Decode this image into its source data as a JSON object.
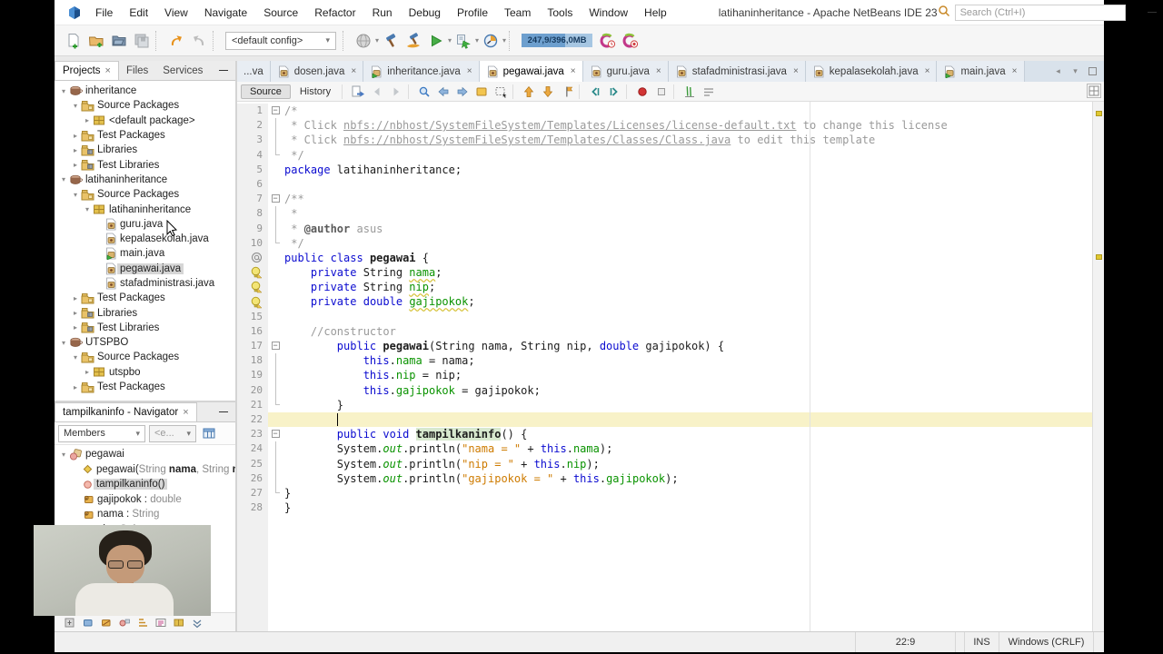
{
  "titlebar": {
    "menus": [
      "File",
      "Edit",
      "View",
      "Navigate",
      "Source",
      "Refactor",
      "Run",
      "Debug",
      "Profile",
      "Team",
      "Tools",
      "Window",
      "Help"
    ],
    "title": "latihaninheritance - Apache NetBeans IDE 23",
    "search_placeholder": "Search (Ctrl+I)"
  },
  "toolbar": {
    "file_icons": [
      "new-file",
      "new-project",
      "open-project",
      "save-all"
    ],
    "edit_icons": [
      "undo",
      "redo"
    ],
    "config_value": "<default config>",
    "run_icons": [
      "web",
      "build",
      "clean-build",
      "run",
      "debug",
      "profile"
    ],
    "memory_label": "247,9/396,0MB",
    "gc_icons": [
      "gc-time",
      "gc-stop"
    ]
  },
  "projects": {
    "tabs": [
      {
        "label": "Projects",
        "active": true,
        "closable": true
      },
      {
        "label": "Files",
        "active": false,
        "closable": false
      },
      {
        "label": "Services",
        "active": false,
        "closable": false
      }
    ],
    "tree": [
      {
        "d": 0,
        "a": "v",
        "icon": "project",
        "label": "inheritance"
      },
      {
        "d": 1,
        "a": "v",
        "icon": "src-pkg",
        "label": "Source Packages"
      },
      {
        "d": 2,
        "a": ">",
        "icon": "package",
        "label": "<default package>"
      },
      {
        "d": 1,
        "a": ">",
        "icon": "src-pkg",
        "label": "Test Packages"
      },
      {
        "d": 1,
        "a": ">",
        "icon": "lib",
        "label": "Libraries"
      },
      {
        "d": 1,
        "a": ">",
        "icon": "lib",
        "label": "Test Libraries"
      },
      {
        "d": 0,
        "a": "v",
        "icon": "project",
        "label": "latihaninheritance"
      },
      {
        "d": 1,
        "a": "v",
        "icon": "src-pkg",
        "label": "Source Packages"
      },
      {
        "d": 2,
        "a": "v",
        "icon": "package",
        "label": "latihaninheritance"
      },
      {
        "d": 3,
        "a": null,
        "icon": "class",
        "label": "guru.java"
      },
      {
        "d": 3,
        "a": null,
        "icon": "class",
        "label": "kepalasekolah.java"
      },
      {
        "d": 3,
        "a": null,
        "icon": "main-class",
        "label": "main.java"
      },
      {
        "d": 3,
        "a": null,
        "icon": "class",
        "label": "pegawai.java",
        "selected": true
      },
      {
        "d": 3,
        "a": null,
        "icon": "class",
        "label": "stafadministrasi.java"
      },
      {
        "d": 1,
        "a": ">",
        "icon": "src-pkg",
        "label": "Test Packages"
      },
      {
        "d": 1,
        "a": ">",
        "icon": "lib",
        "label": "Libraries"
      },
      {
        "d": 1,
        "a": ">",
        "icon": "lib",
        "label": "Test Libraries"
      },
      {
        "d": 0,
        "a": "v",
        "icon": "project",
        "label": "UTSPBO"
      },
      {
        "d": 1,
        "a": "v",
        "icon": "src-pkg",
        "label": "Source Packages"
      },
      {
        "d": 2,
        "a": ">",
        "icon": "package",
        "label": "utspbo"
      },
      {
        "d": 1,
        "a": ">",
        "icon": "src-pkg",
        "label": "Test Packages"
      }
    ]
  },
  "navigator": {
    "title": "tampilkaninfo - Navigator",
    "filter_value": "Members",
    "filter2_value": "<e...",
    "items": [
      {
        "icon": "nav-class",
        "d": 0,
        "a": "v",
        "segs": [
          [
            "p",
            "pegawai"
          ]
        ]
      },
      {
        "icon": "constructor",
        "d": 1,
        "a": null,
        "segs": [
          [
            "p",
            "pegawai("
          ],
          [
            "nav-dim",
            "String "
          ],
          [
            "nav-b",
            "nama"
          ],
          [
            "nav-dim",
            ", String "
          ],
          [
            "nav-b",
            "nip"
          ],
          [
            "nav-dim",
            ","
          ]
        ]
      },
      {
        "icon": "method",
        "d": 1,
        "a": null,
        "selected": true,
        "segs": [
          [
            "p",
            "tampilkaninfo()"
          ]
        ]
      },
      {
        "icon": "field",
        "d": 1,
        "a": null,
        "segs": [
          [
            "p",
            "gajipokok : "
          ],
          [
            "nav-dim",
            "double"
          ]
        ]
      },
      {
        "icon": "field",
        "d": 1,
        "a": null,
        "segs": [
          [
            "p",
            "nama : "
          ],
          [
            "nav-dim",
            "String"
          ]
        ]
      },
      {
        "icon": "field",
        "d": 1,
        "a": null,
        "segs": [
          [
            "p",
            "nip : "
          ],
          [
            "nav-dim",
            "String"
          ]
        ]
      }
    ],
    "bottom_filters": [
      "inherited",
      "fields",
      "static",
      "non-public",
      "sort-alpha",
      "sort-source",
      "fqn",
      "expand"
    ]
  },
  "editor": {
    "tabs": [
      {
        "label": "...va",
        "partial": true
      },
      {
        "label": "dosen.java",
        "icon": "class",
        "closable": true
      },
      {
        "label": "inheritance.java",
        "icon": "main-class",
        "closable": true
      },
      {
        "label": "pegawai.java",
        "icon": "class",
        "closable": true,
        "active": true
      },
      {
        "label": "guru.java",
        "icon": "class",
        "closable": true
      },
      {
        "label": "stafadministrasi.java",
        "icon": "class",
        "closable": true
      },
      {
        "label": "kepalasekolah.java",
        "icon": "class",
        "closable": true
      },
      {
        "label": "main.java",
        "icon": "main-class",
        "closable": true
      }
    ],
    "source_label": "Source",
    "history_label": "History",
    "toolbar_icons": [
      "last-edit",
      "back",
      "forward",
      "find-selection",
      "prev-occurrence",
      "next-occurrence",
      "toggle-highlight",
      "rect-selection",
      "prev-bookmark",
      "next-bookmark",
      "toggle-bookmark",
      "shift-left",
      "shift-right",
      "record-macro",
      "stop-macro",
      "comment",
      "uncomment"
    ],
    "code": {
      "lines": [
        {
          "n": 1,
          "fold": "open",
          "segs": [
            [
              "c",
              "/*"
            ]
          ]
        },
        {
          "n": 2,
          "fold": "mid",
          "segs": [
            [
              "c",
              " * Click "
            ],
            [
              "cl",
              "nbfs://nbhost/SystemFileSystem/Templates/Licenses/license-default.txt"
            ],
            [
              "c",
              " to change this license"
            ]
          ]
        },
        {
          "n": 3,
          "fold": "mid",
          "segs": [
            [
              "c",
              " * Click "
            ],
            [
              "cl",
              "nbfs://nbhost/SystemFileSystem/Templates/Classes/Class.java"
            ],
            [
              "c",
              " to edit this template"
            ]
          ]
        },
        {
          "n": 4,
          "fold": "end",
          "segs": [
            [
              "c",
              " */"
            ]
          ]
        },
        {
          "n": 5,
          "segs": [
            [
              "k",
              "package"
            ],
            [
              "p",
              " latihaninheritance;"
            ]
          ]
        },
        {
          "n": 6,
          "segs": []
        },
        {
          "n": 7,
          "fold": "open",
          "segs": [
            [
              "c",
              "/**"
            ]
          ]
        },
        {
          "n": 8,
          "fold": "mid",
          "segs": [
            [
              "c",
              " *"
            ]
          ]
        },
        {
          "n": 9,
          "fold": "mid",
          "segs": [
            [
              "c",
              " * "
            ],
            [
              "jt",
              "@author"
            ],
            [
              "c",
              " asus"
            ]
          ]
        },
        {
          "n": 10,
          "fold": "end",
          "segs": [
            [
              "c",
              " */"
            ]
          ]
        },
        {
          "n": 11,
          "gicon": "annotation",
          "segs": [
            [
              "k",
              "public"
            ],
            [
              "p",
              " "
            ],
            [
              "k",
              "class"
            ],
            [
              "p",
              " "
            ],
            [
              "b",
              "pegawai"
            ],
            [
              "p",
              " {"
            ]
          ]
        },
        {
          "n": 12,
          "gicon": "warning",
          "segs": [
            [
              "p",
              "    "
            ],
            [
              "k",
              "private"
            ],
            [
              "p",
              " String "
            ],
            [
              "fu",
              "nama"
            ],
            [
              "p",
              ";"
            ]
          ]
        },
        {
          "n": 13,
          "gicon": "warning",
          "segs": [
            [
              "p",
              "    "
            ],
            [
              "k",
              "private"
            ],
            [
              "p",
              " String "
            ],
            [
              "fu",
              "nip"
            ],
            [
              "p",
              ";"
            ]
          ]
        },
        {
          "n": 14,
          "gicon": "warning",
          "segs": [
            [
              "p",
              "    "
            ],
            [
              "k",
              "private"
            ],
            [
              "p",
              " "
            ],
            [
              "k",
              "double"
            ],
            [
              "p",
              " "
            ],
            [
              "fu",
              "gajipokok"
            ],
            [
              "p",
              ";"
            ]
          ]
        },
        {
          "n": 15,
          "segs": []
        },
        {
          "n": 16,
          "segs": [
            [
              "p",
              "    "
            ],
            [
              "c",
              "//constructor"
            ]
          ]
        },
        {
          "n": 17,
          "fold": "open",
          "segs": [
            [
              "p",
              "        "
            ],
            [
              "k",
              "public"
            ],
            [
              "p",
              " "
            ],
            [
              "b",
              "pegawai"
            ],
            [
              "p",
              "(String nama, String nip, "
            ],
            [
              "k",
              "double"
            ],
            [
              "p",
              " gajipokok) {"
            ]
          ]
        },
        {
          "n": 18,
          "fold": "mid",
          "segs": [
            [
              "p",
              "            "
            ],
            [
              "k",
              "this"
            ],
            [
              "p",
              "."
            ],
            [
              "f",
              "nama"
            ],
            [
              "p",
              " = nama;"
            ]
          ]
        },
        {
          "n": 19,
          "fold": "mid",
          "segs": [
            [
              "p",
              "            "
            ],
            [
              "k",
              "this"
            ],
            [
              "p",
              "."
            ],
            [
              "f",
              "nip"
            ],
            [
              "p",
              " = nip;"
            ]
          ]
        },
        {
          "n": 20,
          "fold": "mid",
          "segs": [
            [
              "p",
              "            "
            ],
            [
              "k",
              "this"
            ],
            [
              "p",
              "."
            ],
            [
              "f",
              "gajipokok"
            ],
            [
              "p",
              " = gajipokok;"
            ]
          ]
        },
        {
          "n": 21,
          "fold": "end",
          "segs": [
            [
              "p",
              "        }"
            ]
          ]
        },
        {
          "n": 22,
          "current": true,
          "caret_col": 8,
          "segs": [
            [
              "p",
              "        "
            ]
          ]
        },
        {
          "n": 23,
          "fold": "open",
          "segs": [
            [
              "p",
              "        "
            ],
            [
              "k",
              "public"
            ],
            [
              "p",
              " "
            ],
            [
              "k",
              "void"
            ],
            [
              "p",
              " "
            ],
            [
              "bh",
              "tampilkaninfo"
            ],
            [
              "p",
              "() {"
            ]
          ]
        },
        {
          "n": 24,
          "fold": "mid",
          "segs": [
            [
              "p",
              "        System."
            ],
            [
              "it",
              "out"
            ],
            [
              "p",
              ".println("
            ],
            [
              "s",
              "\"nama = \""
            ],
            [
              "p",
              " + "
            ],
            [
              "k",
              "this"
            ],
            [
              "p",
              "."
            ],
            [
              "f",
              "nama"
            ],
            [
              "p",
              ");"
            ]
          ]
        },
        {
          "n": 25,
          "fold": "mid",
          "segs": [
            [
              "p",
              "        System."
            ],
            [
              "it",
              "out"
            ],
            [
              "p",
              ".println("
            ],
            [
              "s",
              "\"nip = \""
            ],
            [
              "p",
              " + "
            ],
            [
              "k",
              "this"
            ],
            [
              "p",
              "."
            ],
            [
              "f",
              "nip"
            ],
            [
              "p",
              ");"
            ]
          ]
        },
        {
          "n": 26,
          "fold": "mid",
          "segs": [
            [
              "p",
              "        System."
            ],
            [
              "it",
              "out"
            ],
            [
              "p",
              ".println("
            ],
            [
              "s",
              "\"gajipokok = \""
            ],
            [
              "p",
              " + "
            ],
            [
              "k",
              "this"
            ],
            [
              "p",
              "."
            ],
            [
              "f",
              "gajipokok"
            ],
            [
              "p",
              ");"
            ]
          ]
        },
        {
          "n": 27,
          "fold": "end",
          "segs": [
            [
              "p",
              "}"
            ]
          ]
        },
        {
          "n": 28,
          "segs": [
            [
              "p",
              "}"
            ]
          ]
        }
      ]
    }
  },
  "statusbar": {
    "caret": "22:9",
    "insert_mode": "INS",
    "line_ending": "Windows (CRLF)"
  }
}
